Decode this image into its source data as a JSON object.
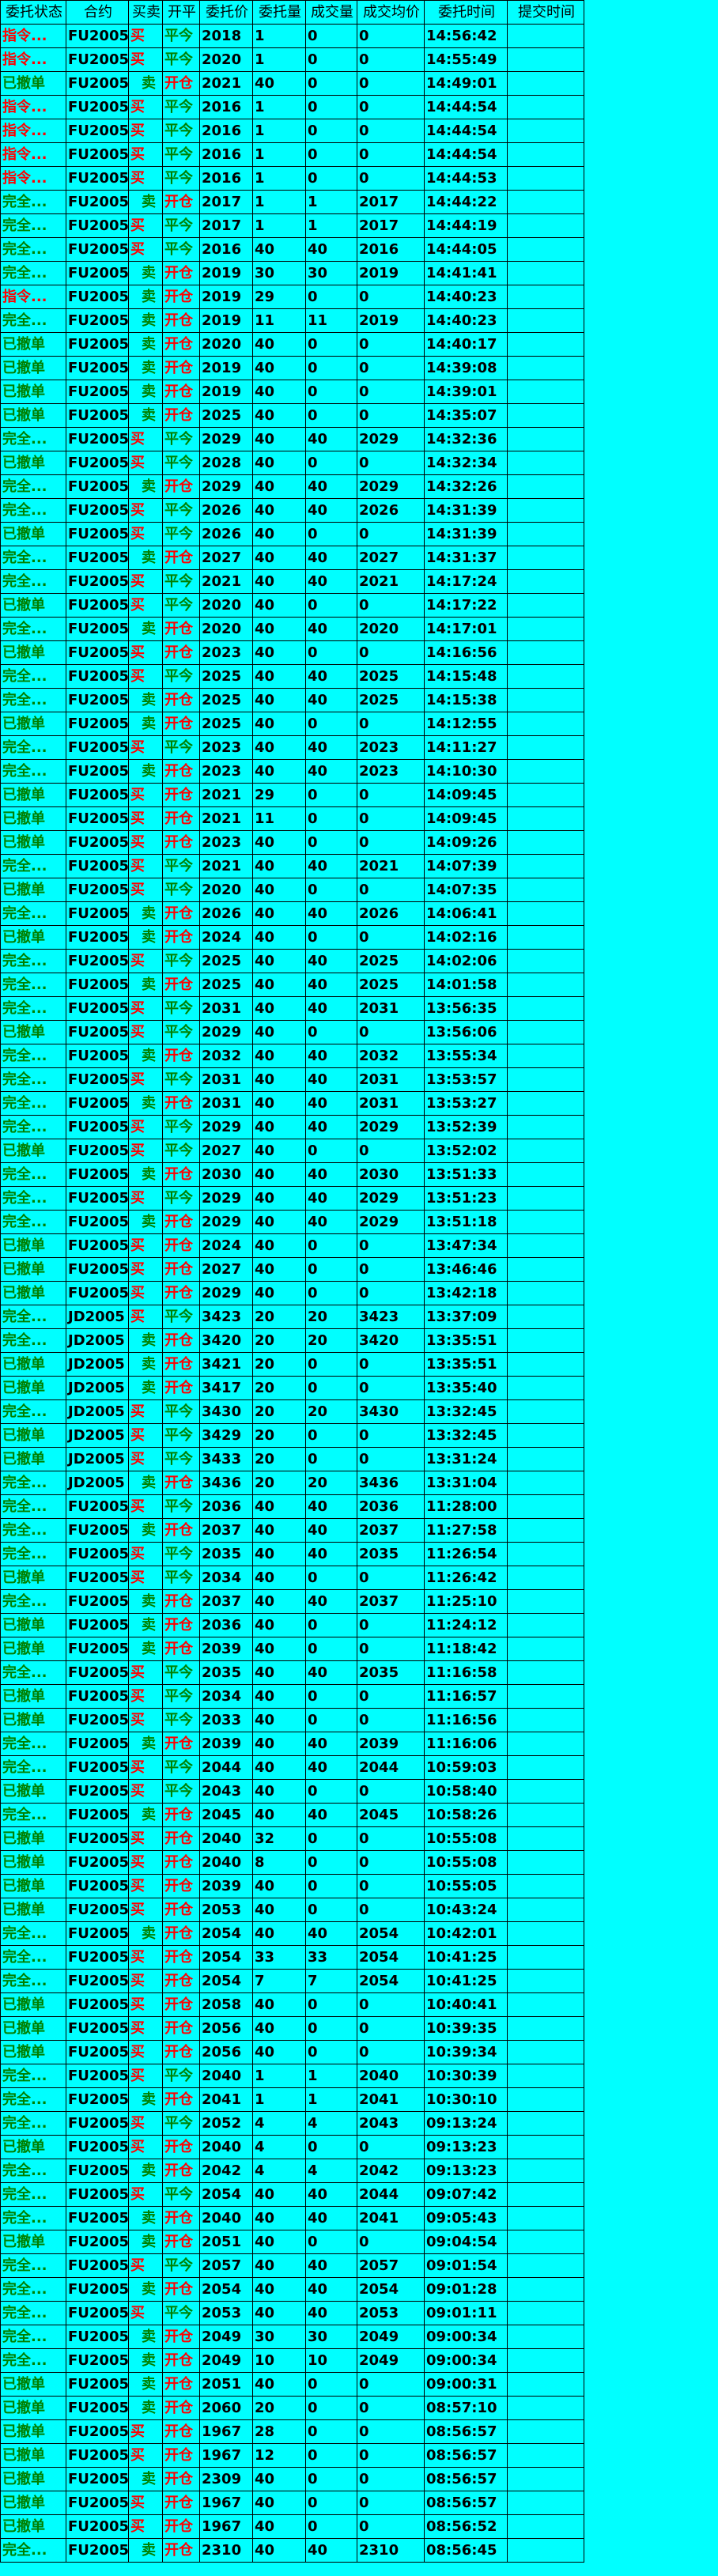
{
  "headers": [
    "委托状态",
    "合约",
    "买卖",
    "开平",
    "委托价",
    "委托量",
    "成交量",
    "成交均价",
    "委托时间",
    "提交时间"
  ],
  "colors": {
    "background": "#00ffff",
    "buy": "#ff0000",
    "sell": "#008000",
    "open": "#ff0000",
    "close": "#008000"
  },
  "rows": [
    [
      "指令...",
      "FU2005",
      "买",
      "平今",
      "2018",
      "1",
      "0",
      "0",
      "14:56:42",
      ""
    ],
    [
      "指令...",
      "FU2005",
      "买",
      "平今",
      "2020",
      "1",
      "0",
      "0",
      "14:55:49",
      ""
    ],
    [
      "已撤单",
      "FU2005",
      "卖",
      "开仓",
      "2021",
      "40",
      "0",
      "0",
      "14:49:01",
      ""
    ],
    [
      "指令...",
      "FU2005",
      "买",
      "平今",
      "2016",
      "1",
      "0",
      "0",
      "14:44:54",
      ""
    ],
    [
      "指令...",
      "FU2005",
      "买",
      "平今",
      "2016",
      "1",
      "0",
      "0",
      "14:44:54",
      ""
    ],
    [
      "指令...",
      "FU2005",
      "买",
      "平今",
      "2016",
      "1",
      "0",
      "0",
      "14:44:54",
      ""
    ],
    [
      "指令...",
      "FU2005",
      "买",
      "平今",
      "2016",
      "1",
      "0",
      "0",
      "14:44:53",
      ""
    ],
    [
      "完全...",
      "FU2005",
      "卖",
      "开仓",
      "2017",
      "1",
      "1",
      "2017",
      "14:44:22",
      ""
    ],
    [
      "完全...",
      "FU2005",
      "买",
      "平今",
      "2017",
      "1",
      "1",
      "2017",
      "14:44:19",
      ""
    ],
    [
      "完全...",
      "FU2005",
      "买",
      "平今",
      "2016",
      "40",
      "40",
      "2016",
      "14:44:05",
      ""
    ],
    [
      "完全...",
      "FU2005",
      "卖",
      "开仓",
      "2019",
      "30",
      "30",
      "2019",
      "14:41:41",
      ""
    ],
    [
      "指令...",
      "FU2005",
      "卖",
      "开仓",
      "2019",
      "29",
      "0",
      "0",
      "14:40:23",
      ""
    ],
    [
      "完全...",
      "FU2005",
      "卖",
      "开仓",
      "2019",
      "11",
      "11",
      "2019",
      "14:40:23",
      ""
    ],
    [
      "已撤单",
      "FU2005",
      "卖",
      "开仓",
      "2020",
      "40",
      "0",
      "0",
      "14:40:17",
      ""
    ],
    [
      "已撤单",
      "FU2005",
      "卖",
      "开仓",
      "2019",
      "40",
      "0",
      "0",
      "14:39:08",
      ""
    ],
    [
      "已撤单",
      "FU2005",
      "卖",
      "开仓",
      "2019",
      "40",
      "0",
      "0",
      "14:39:01",
      ""
    ],
    [
      "已撤单",
      "FU2005",
      "卖",
      "开仓",
      "2025",
      "40",
      "0",
      "0",
      "14:35:07",
      ""
    ],
    [
      "完全...",
      "FU2005",
      "买",
      "平今",
      "2029",
      "40",
      "40",
      "2029",
      "14:32:36",
      ""
    ],
    [
      "已撤单",
      "FU2005",
      "买",
      "平今",
      "2028",
      "40",
      "0",
      "0",
      "14:32:34",
      ""
    ],
    [
      "完全...",
      "FU2005",
      "卖",
      "开仓",
      "2029",
      "40",
      "40",
      "2029",
      "14:32:26",
      ""
    ],
    [
      "完全...",
      "FU2005",
      "买",
      "平今",
      "2026",
      "40",
      "40",
      "2026",
      "14:31:39",
      ""
    ],
    [
      "已撤单",
      "FU2005",
      "买",
      "平今",
      "2026",
      "40",
      "0",
      "0",
      "14:31:39",
      ""
    ],
    [
      "完全...",
      "FU2005",
      "卖",
      "开仓",
      "2027",
      "40",
      "40",
      "2027",
      "14:31:37",
      ""
    ],
    [
      "完全...",
      "FU2005",
      "买",
      "平今",
      "2021",
      "40",
      "40",
      "2021",
      "14:17:24",
      ""
    ],
    [
      "已撤单",
      "FU2005",
      "买",
      "平今",
      "2020",
      "40",
      "0",
      "0",
      "14:17:22",
      ""
    ],
    [
      "完全...",
      "FU2005",
      "卖",
      "开仓",
      "2020",
      "40",
      "40",
      "2020",
      "14:17:01",
      ""
    ],
    [
      "已撤单",
      "FU2005",
      "买",
      "开仓",
      "2023",
      "40",
      "0",
      "0",
      "14:16:56",
      ""
    ],
    [
      "完全...",
      "FU2005",
      "买",
      "平今",
      "2025",
      "40",
      "40",
      "2025",
      "14:15:48",
      ""
    ],
    [
      "完全...",
      "FU2005",
      "卖",
      "开仓",
      "2025",
      "40",
      "40",
      "2025",
      "14:15:38",
      ""
    ],
    [
      "已撤单",
      "FU2005",
      "卖",
      "开仓",
      "2025",
      "40",
      "0",
      "0",
      "14:12:55",
      ""
    ],
    [
      "完全...",
      "FU2005",
      "买",
      "平今",
      "2023",
      "40",
      "40",
      "2023",
      "14:11:27",
      ""
    ],
    [
      "完全...",
      "FU2005",
      "卖",
      "开仓",
      "2023",
      "40",
      "40",
      "2023",
      "14:10:30",
      ""
    ],
    [
      "已撤单",
      "FU2005",
      "买",
      "开仓",
      "2021",
      "29",
      "0",
      "0",
      "14:09:45",
      ""
    ],
    [
      "已撤单",
      "FU2005",
      "买",
      "开仓",
      "2021",
      "11",
      "0",
      "0",
      "14:09:45",
      ""
    ],
    [
      "已撤单",
      "FU2005",
      "买",
      "开仓",
      "2023",
      "40",
      "0",
      "0",
      "14:09:26",
      ""
    ],
    [
      "完全...",
      "FU2005",
      "买",
      "平今",
      "2021",
      "40",
      "40",
      "2021",
      "14:07:39",
      ""
    ],
    [
      "已撤单",
      "FU2005",
      "买",
      "平今",
      "2020",
      "40",
      "0",
      "0",
      "14:07:35",
      ""
    ],
    [
      "完全...",
      "FU2005",
      "卖",
      "开仓",
      "2026",
      "40",
      "40",
      "2026",
      "14:06:41",
      ""
    ],
    [
      "已撤单",
      "FU2005",
      "卖",
      "开仓",
      "2024",
      "40",
      "0",
      "0",
      "14:02:16",
      ""
    ],
    [
      "完全...",
      "FU2005",
      "买",
      "平今",
      "2025",
      "40",
      "40",
      "2025",
      "14:02:06",
      ""
    ],
    [
      "完全...",
      "FU2005",
      "卖",
      "开仓",
      "2025",
      "40",
      "40",
      "2025",
      "14:01:58",
      ""
    ],
    [
      "完全...",
      "FU2005",
      "买",
      "平今",
      "2031",
      "40",
      "40",
      "2031",
      "13:56:35",
      ""
    ],
    [
      "已撤单",
      "FU2005",
      "买",
      "平今",
      "2029",
      "40",
      "0",
      "0",
      "13:56:06",
      ""
    ],
    [
      "完全...",
      "FU2005",
      "卖",
      "开仓",
      "2032",
      "40",
      "40",
      "2032",
      "13:55:34",
      ""
    ],
    [
      "完全...",
      "FU2005",
      "买",
      "平今",
      "2031",
      "40",
      "40",
      "2031",
      "13:53:57",
      ""
    ],
    [
      "完全...",
      "FU2005",
      "卖",
      "开仓",
      "2031",
      "40",
      "40",
      "2031",
      "13:53:27",
      ""
    ],
    [
      "完全...",
      "FU2005",
      "买",
      "平今",
      "2029",
      "40",
      "40",
      "2029",
      "13:52:39",
      ""
    ],
    [
      "已撤单",
      "FU2005",
      "买",
      "平今",
      "2027",
      "40",
      "0",
      "0",
      "13:52:02",
      ""
    ],
    [
      "完全...",
      "FU2005",
      "卖",
      "开仓",
      "2030",
      "40",
      "40",
      "2030",
      "13:51:33",
      ""
    ],
    [
      "完全...",
      "FU2005",
      "买",
      "平今",
      "2029",
      "40",
      "40",
      "2029",
      "13:51:23",
      ""
    ],
    [
      "完全...",
      "FU2005",
      "卖",
      "开仓",
      "2029",
      "40",
      "40",
      "2029",
      "13:51:18",
      ""
    ],
    [
      "已撤单",
      "FU2005",
      "买",
      "开仓",
      "2024",
      "40",
      "0",
      "0",
      "13:47:34",
      ""
    ],
    [
      "已撤单",
      "FU2005",
      "买",
      "开仓",
      "2027",
      "40",
      "0",
      "0",
      "13:46:46",
      ""
    ],
    [
      "已撤单",
      "FU2005",
      "买",
      "开仓",
      "2029",
      "40",
      "0",
      "0",
      "13:42:18",
      ""
    ],
    [
      "完全...",
      "JD2005",
      "买",
      "平今",
      "3423",
      "20",
      "20",
      "3423",
      "13:37:09",
      ""
    ],
    [
      "完全...",
      "JD2005",
      "卖",
      "开仓",
      "3420",
      "20",
      "20",
      "3420",
      "13:35:51",
      ""
    ],
    [
      "已撤单",
      "JD2005",
      "卖",
      "开仓",
      "3421",
      "20",
      "0",
      "0",
      "13:35:51",
      ""
    ],
    [
      "已撤单",
      "JD2005",
      "卖",
      "开仓",
      "3417",
      "20",
      "0",
      "0",
      "13:35:40",
      ""
    ],
    [
      "完全...",
      "JD2005",
      "买",
      "平今",
      "3430",
      "20",
      "20",
      "3430",
      "13:32:45",
      ""
    ],
    [
      "已撤单",
      "JD2005",
      "买",
      "平今",
      "3429",
      "20",
      "0",
      "0",
      "13:32:45",
      ""
    ],
    [
      "已撤单",
      "JD2005",
      "买",
      "平今",
      "3433",
      "20",
      "0",
      "0",
      "13:31:24",
      ""
    ],
    [
      "完全...",
      "JD2005",
      "卖",
      "开仓",
      "3436",
      "20",
      "20",
      "3436",
      "13:31:04",
      ""
    ],
    [
      "完全...",
      "FU2005",
      "买",
      "平今",
      "2036",
      "40",
      "40",
      "2036",
      "11:28:00",
      ""
    ],
    [
      "完全...",
      "FU2005",
      "卖",
      "开仓",
      "2037",
      "40",
      "40",
      "2037",
      "11:27:58",
      ""
    ],
    [
      "完全...",
      "FU2005",
      "买",
      "平今",
      "2035",
      "40",
      "40",
      "2035",
      "11:26:54",
      ""
    ],
    [
      "已撤单",
      "FU2005",
      "买",
      "平今",
      "2034",
      "40",
      "0",
      "0",
      "11:26:42",
      ""
    ],
    [
      "完全...",
      "FU2005",
      "卖",
      "开仓",
      "2037",
      "40",
      "40",
      "2037",
      "11:25:10",
      ""
    ],
    [
      "已撤单",
      "FU2005",
      "卖",
      "开仓",
      "2036",
      "40",
      "0",
      "0",
      "11:24:12",
      ""
    ],
    [
      "已撤单",
      "FU2005",
      "卖",
      "开仓",
      "2039",
      "40",
      "0",
      "0",
      "11:18:42",
      ""
    ],
    [
      "完全...",
      "FU2005",
      "买",
      "平今",
      "2035",
      "40",
      "40",
      "2035",
      "11:16:58",
      ""
    ],
    [
      "已撤单",
      "FU2005",
      "买",
      "平今",
      "2034",
      "40",
      "0",
      "0",
      "11:16:57",
      ""
    ],
    [
      "已撤单",
      "FU2005",
      "买",
      "平今",
      "2033",
      "40",
      "0",
      "0",
      "11:16:56",
      ""
    ],
    [
      "完全...",
      "FU2005",
      "卖",
      "开仓",
      "2039",
      "40",
      "40",
      "2039",
      "11:16:06",
      ""
    ],
    [
      "完全...",
      "FU2005",
      "买",
      "平今",
      "2044",
      "40",
      "40",
      "2044",
      "10:59:03",
      ""
    ],
    [
      "已撤单",
      "FU2005",
      "买",
      "平今",
      "2043",
      "40",
      "0",
      "0",
      "10:58:40",
      ""
    ],
    [
      "完全...",
      "FU2005",
      "卖",
      "开仓",
      "2045",
      "40",
      "40",
      "2045",
      "10:58:26",
      ""
    ],
    [
      "已撤单",
      "FU2005",
      "买",
      "开仓",
      "2040",
      "32",
      "0",
      "0",
      "10:55:08",
      ""
    ],
    [
      "已撤单",
      "FU2005",
      "买",
      "开仓",
      "2040",
      "8",
      "0",
      "0",
      "10:55:08",
      ""
    ],
    [
      "已撤单",
      "FU2005",
      "买",
      "开仓",
      "2039",
      "40",
      "0",
      "0",
      "10:55:05",
      ""
    ],
    [
      "已撤单",
      "FU2005",
      "买",
      "开仓",
      "2053",
      "40",
      "0",
      "0",
      "10:43:24",
      ""
    ],
    [
      "完全...",
      "FU2005",
      "卖",
      "开仓",
      "2054",
      "40",
      "40",
      "2054",
      "10:42:01",
      ""
    ],
    [
      "完全...",
      "FU2005",
      "买",
      "开仓",
      "2054",
      "33",
      "33",
      "2054",
      "10:41:25",
      ""
    ],
    [
      "完全...",
      "FU2005",
      "买",
      "开仓",
      "2054",
      "7",
      "7",
      "2054",
      "10:41:25",
      ""
    ],
    [
      "已撤单",
      "FU2005",
      "买",
      "开仓",
      "2058",
      "40",
      "0",
      "0",
      "10:40:41",
      ""
    ],
    [
      "已撤单",
      "FU2005",
      "买",
      "开仓",
      "2056",
      "40",
      "0",
      "0",
      "10:39:35",
      ""
    ],
    [
      "已撤单",
      "FU2005",
      "买",
      "开仓",
      "2056",
      "40",
      "0",
      "0",
      "10:39:34",
      ""
    ],
    [
      "完全...",
      "FU2005",
      "买",
      "平今",
      "2040",
      "1",
      "1",
      "2040",
      "10:30:39",
      ""
    ],
    [
      "完全...",
      "FU2005",
      "卖",
      "开仓",
      "2041",
      "1",
      "1",
      "2041",
      "10:30:10",
      ""
    ],
    [
      "完全...",
      "FU2005",
      "买",
      "平今",
      "2052",
      "4",
      "4",
      "2043",
      "09:13:24",
      ""
    ],
    [
      "已撤单",
      "FU2005",
      "买",
      "开仓",
      "2040",
      "4",
      "0",
      "0",
      "09:13:23",
      ""
    ],
    [
      "完全...",
      "FU2005",
      "卖",
      "开仓",
      "2042",
      "4",
      "4",
      "2042",
      "09:13:23",
      ""
    ],
    [
      "完全...",
      "FU2005",
      "买",
      "平今",
      "2054",
      "40",
      "40",
      "2044",
      "09:07:42",
      ""
    ],
    [
      "完全...",
      "FU2005",
      "卖",
      "开仓",
      "2040",
      "40",
      "40",
      "2041",
      "09:05:43",
      ""
    ],
    [
      "已撤单",
      "FU2005",
      "卖",
      "开仓",
      "2051",
      "40",
      "0",
      "0",
      "09:04:54",
      ""
    ],
    [
      "完全...",
      "FU2005",
      "买",
      "平今",
      "2057",
      "40",
      "40",
      "2057",
      "09:01:54",
      ""
    ],
    [
      "完全...",
      "FU2005",
      "卖",
      "开仓",
      "2054",
      "40",
      "40",
      "2054",
      "09:01:28",
      ""
    ],
    [
      "完全...",
      "FU2005",
      "买",
      "平今",
      "2053",
      "40",
      "40",
      "2053",
      "09:01:11",
      ""
    ],
    [
      "完全...",
      "FU2005",
      "卖",
      "开仓",
      "2049",
      "30",
      "30",
      "2049",
      "09:00:34",
      ""
    ],
    [
      "完全...",
      "FU2005",
      "卖",
      "开仓",
      "2049",
      "10",
      "10",
      "2049",
      "09:00:34",
      ""
    ],
    [
      "已撤单",
      "FU2005",
      "卖",
      "开仓",
      "2051",
      "40",
      "0",
      "0",
      "09:00:31",
      ""
    ],
    [
      "已撤单",
      "FU2005",
      "卖",
      "开仓",
      "2060",
      "20",
      "0",
      "0",
      "08:57:10",
      ""
    ],
    [
      "已撤单",
      "FU2005",
      "买",
      "开仓",
      "1967",
      "28",
      "0",
      "0",
      "08:56:57",
      ""
    ],
    [
      "已撤单",
      "FU2005",
      "买",
      "开仓",
      "1967",
      "12",
      "0",
      "0",
      "08:56:57",
      ""
    ],
    [
      "已撤单",
      "FU2005",
      "卖",
      "开仓",
      "2309",
      "40",
      "0",
      "0",
      "08:56:57",
      ""
    ],
    [
      "已撤单",
      "FU2005",
      "买",
      "开仓",
      "1967",
      "40",
      "0",
      "0",
      "08:56:57",
      ""
    ],
    [
      "已撤单",
      "FU2005",
      "买",
      "开仓",
      "1967",
      "40",
      "0",
      "0",
      "08:56:52",
      ""
    ],
    [
      "完全...",
      "FU2005",
      "卖",
      "开仓",
      "2310",
      "40",
      "40",
      "2310",
      "08:56:45",
      ""
    ]
  ]
}
